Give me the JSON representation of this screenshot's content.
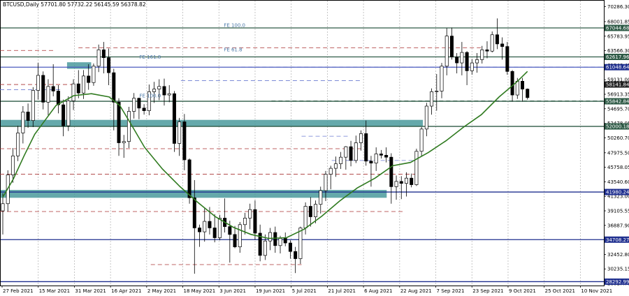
{
  "chart_data": {
    "type": "candlestick",
    "title": "BTCUSD,Daily  57701.80  57732.22  56145.59  56378.82",
    "y_tick_labels": [
      "70286.30",
      "68001.85",
      "65783.95",
      "63566.30",
      "61348.45",
      "59131.00",
      "56913.35",
      "54695.70",
      "52478.05",
      "50260.70",
      "47975.50",
      "45758.05",
      "43540.60",
      "41323.00",
      "39105.55",
      "36887.90",
      "34670.25",
      "32452.80",
      "30235.15",
      "28017.70"
    ],
    "x_tick_labels": [
      "27 Feb 2021",
      "15 Mar 2021",
      "31 Mar 2021",
      "16 Apr 2021",
      "2 May 2021",
      "18 May 2021",
      "3 Jun 2021",
      "19 Jun 2021",
      "5 Jul 2021",
      "21 Jul 2021",
      "6 Aug 2021",
      "22 Aug 2021",
      "7 Sep 2021",
      "23 Sep 2021",
      "9 Oct 2021",
      "25 Oct 2021",
      "10 Nov 2021"
    ],
    "ylim": [
      27700,
      71200
    ],
    "price_boxes": [
      {
        "text": "67044.68",
        "value": 67044.68,
        "color": "#2e5a46",
        "line": "#2e5a46"
      },
      {
        "text": "62617.96",
        "value": 62617.96,
        "color": "#2e5a46",
        "line": "#2e5a46"
      },
      {
        "text": "61048.64",
        "value": 61048.64,
        "color": "#1f2f8f",
        "line": "#4b5bbf"
      },
      {
        "text": "58141.84",
        "value": 58400,
        "color": "#222222",
        "line": ""
      },
      {
        "text": "55842.84",
        "value": 55842.84,
        "color": "#2e5a46",
        "line": "#2e5a46"
      },
      {
        "text": "52000.18",
        "value": 52000.18,
        "color": "#2e5a46",
        "line": "#2e5a46"
      },
      {
        "text": "41980.24",
        "value": 41980.24,
        "color": "#1f2f8f",
        "line": "#1f2f8f"
      },
      {
        "text": "34708.27",
        "value": 34708.27,
        "color": "#1f2f8f",
        "line": "#1f2f8f"
      },
      {
        "text": "28292.99",
        "value": 28292.99,
        "color": "#1f2f8f",
        "line": "#1f2f8f"
      }
    ],
    "fib_labels": [
      {
        "text": "FE 100.0",
        "value": 67044.68,
        "x_frac": 0.37
      },
      {
        "text": "FE 61.8",
        "value": 63300,
        "x_frac": 0.37
      },
      {
        "text": "FE 161.8",
        "value": 62200,
        "x_frac": 0.23
      },
      {
        "text": "FE 100.0",
        "value": 56250,
        "x_frac": 0.23
      }
    ],
    "zones": [
      {
        "from": 52000,
        "to": 53000,
        "x0": 0.0,
        "x1": 0.7,
        "color": "#4a9a9c"
      },
      {
        "from": 41100,
        "to": 42300,
        "x0": 0.0,
        "x1": 0.64,
        "color": "#4a9a9c"
      },
      {
        "from": 60800,
        "to": 61800,
        "x0": 0.11,
        "x1": 0.15,
        "color": "#4a9a9c"
      }
    ],
    "ma_points": [
      [
        0,
        41200
      ],
      [
        6,
        44000
      ],
      [
        12,
        47500
      ],
      [
        18,
        50800
      ],
      [
        24,
        53000
      ],
      [
        30,
        55200
      ],
      [
        40,
        56700
      ],
      [
        50,
        57000
      ],
      [
        60,
        56500
      ],
      [
        66,
        55200
      ],
      [
        72,
        52500
      ],
      [
        80,
        48800
      ],
      [
        90,
        45500
      ],
      [
        100,
        42800
      ],
      [
        110,
        40400
      ],
      [
        120,
        38200
      ],
      [
        130,
        36600
      ],
      [
        140,
        35500
      ],
      [
        150,
        34900
      ],
      [
        160,
        35000
      ],
      [
        170,
        36300
      ],
      [
        180,
        38300
      ],
      [
        190,
        40600
      ],
      [
        200,
        42600
      ],
      [
        210,
        44100
      ],
      [
        220,
        46000
      ],
      [
        230,
        46500
      ],
      [
        240,
        48000
      ],
      [
        250,
        49800
      ],
      [
        260,
        51900
      ],
      [
        270,
        53800
      ],
      [
        280,
        56500
      ],
      [
        290,
        58800
      ],
      [
        296,
        60400
      ]
    ],
    "candles": [
      [
        0,
        39100,
        41800,
        35500,
        40200
      ],
      [
        1,
        40200,
        45300,
        39000,
        44600
      ],
      [
        2,
        44600,
        48700,
        43400,
        47500
      ],
      [
        3,
        47500,
        52100,
        46700,
        51000
      ],
      [
        4,
        51000,
        55100,
        49400,
        54200
      ],
      [
        5,
        54200,
        55500,
        51800,
        52900
      ],
      [
        6,
        52900,
        58000,
        51900,
        57500
      ],
      [
        7,
        57500,
        61700,
        56100,
        59800
      ],
      [
        8,
        59800,
        60400,
        54600,
        55700
      ],
      [
        9,
        55700,
        59200,
        53700,
        58100
      ],
      [
        10,
        58100,
        61500,
        56600,
        57400
      ],
      [
        11,
        57400,
        58300,
        54000,
        55300
      ],
      [
        12,
        55300,
        56100,
        50500,
        52100
      ],
      [
        13,
        52100,
        56600,
        51300,
        55900
      ],
      [
        14,
        55900,
        59200,
        54500,
        58500
      ],
      [
        15,
        58500,
        60600,
        56300,
        57100
      ],
      [
        16,
        57100,
        60600,
        56200,
        59700
      ],
      [
        17,
        59700,
        61500,
        57600,
        58700
      ],
      [
        18,
        58700,
        61600,
        58200,
        61200
      ],
      [
        19,
        61200,
        64500,
        60300,
        63700
      ],
      [
        20,
        63700,
        64900,
        60100,
        62500
      ],
      [
        21,
        62500,
        63900,
        58300,
        60200
      ],
      [
        22,
        60200,
        60800,
        51400,
        55700
      ],
      [
        23,
        55700,
        56300,
        47500,
        49500
      ],
      [
        24,
        49500,
        50700,
        47200,
        49700
      ],
      [
        25,
        49700,
        55000,
        48700,
        54300
      ],
      [
        26,
        54300,
        57100,
        53200,
        56300
      ],
      [
        27,
        56300,
        56400,
        53100,
        54800
      ],
      [
        28,
        54800,
        55400,
        53800,
        54400
      ],
      [
        29,
        54400,
        58400,
        53700,
        57300
      ],
      [
        30,
        57300,
        58800,
        55600,
        57700
      ],
      [
        31,
        57700,
        59200,
        56000,
        58100
      ],
      [
        32,
        58100,
        59300,
        55200,
        56800
      ],
      [
        33,
        56800,
        58300,
        55700,
        57000
      ],
      [
        34,
        57000,
        57400,
        48100,
        49400
      ],
      [
        35,
        49400,
        53300,
        47500,
        52700
      ],
      [
        36,
        52700,
        53900,
        45300,
        46900
      ],
      [
        37,
        46900,
        47100,
        40200,
        41100
      ],
      [
        38,
        41100,
        43800,
        29500,
        36500
      ],
      [
        39,
        36500,
        37000,
        33600,
        35900
      ],
      [
        40,
        35900,
        39500,
        34400,
        37500
      ],
      [
        41,
        37500,
        39700,
        35500,
        36500
      ],
      [
        42,
        36500,
        38600,
        34300,
        35000
      ],
      [
        43,
        35000,
        38500,
        34600,
        38000
      ],
      [
        44,
        38000,
        41000,
        35800,
        36700
      ],
      [
        45,
        36700,
        37600,
        31200,
        35500
      ],
      [
        46,
        35500,
        36800,
        33400,
        33600
      ],
      [
        47,
        33600,
        37400,
        32700,
        37000
      ],
      [
        48,
        37000,
        38800,
        35500,
        38000
      ],
      [
        49,
        38000,
        40200,
        36300,
        39300
      ],
      [
        50,
        39300,
        40700,
        34700,
        35700
      ],
      [
        51,
        35700,
        37000,
        31400,
        32300
      ],
      [
        52,
        32300,
        35500,
        31600,
        34500
      ],
      [
        53,
        34500,
        36500,
        33100,
        35800
      ],
      [
        54,
        35800,
        36700,
        32700,
        33800
      ],
      [
        55,
        33800,
        35300,
        32600,
        34900
      ],
      [
        56,
        34900,
        35800,
        33700,
        34200
      ],
      [
        57,
        34200,
        34600,
        31800,
        32900
      ],
      [
        58,
        32900,
        33600,
        29600,
        31800
      ],
      [
        59,
        31800,
        36700,
        31000,
        36500
      ],
      [
        60,
        36500,
        40400,
        35500,
        39800
      ],
      [
        61,
        39800,
        41200,
        36700,
        38200
      ],
      [
        62,
        38200,
        40700,
        37200,
        40100
      ],
      [
        63,
        40100,
        42800,
        38700,
        42200
      ],
      [
        64,
        42200,
        45200,
        40600,
        44700
      ],
      [
        65,
        44700,
        46000,
        42400,
        45600
      ],
      [
        66,
        45600,
        47400,
        44300,
        46300
      ],
      [
        67,
        46300,
        48100,
        45500,
        47300
      ],
      [
        68,
        47300,
        49000,
        45400,
        48900
      ],
      [
        69,
        48900,
        49800,
        45900,
        46800
      ],
      [
        70,
        46800,
        50600,
        46400,
        49500
      ],
      [
        71,
        49500,
        51400,
        48300,
        50900
      ],
      [
        72,
        50900,
        52900,
        46000,
        46700
      ],
      [
        73,
        46700,
        47500,
        42800,
        46400
      ],
      [
        74,
        46400,
        48800,
        45200,
        47800
      ],
      [
        75,
        47800,
        48400,
        47100,
        47600
      ],
      [
        76,
        47600,
        48800,
        46500,
        47300
      ],
      [
        77,
        47300,
        47900,
        40200,
        42800
      ],
      [
        78,
        42800,
        44500,
        40800,
        43600
      ],
      [
        79,
        43600,
        44400,
        40900,
        43300
      ],
      [
        80,
        43300,
        45000,
        41300,
        44100
      ],
      [
        81,
        44100,
        44800,
        42700,
        43100
      ],
      [
        82,
        43100,
        48600,
        42900,
        48200
      ],
      [
        83,
        48200,
        51900,
        47500,
        51600
      ],
      [
        84,
        51600,
        55600,
        50500,
        55100
      ],
      [
        85,
        55100,
        57800,
        53800,
        57300
      ],
      [
        86,
        57300,
        60000,
        54400,
        57400
      ],
      [
        87,
        57400,
        61700,
        56300,
        61200
      ],
      [
        88,
        61200,
        67000,
        59800,
        65800
      ],
      [
        89,
        65800,
        67100,
        62200,
        62600
      ],
      [
        90,
        62600,
        63200,
        60100,
        61700
      ],
      [
        91,
        61700,
        64900,
        59800,
        63300
      ],
      [
        92,
        63300,
        63500,
        58300,
        60500
      ],
      [
        93,
        60500,
        62300,
        59900,
        61700
      ],
      [
        94,
        61700,
        63200,
        60200,
        62200
      ],
      [
        95,
        62200,
        64300,
        61600,
        63700
      ],
      [
        96,
        63700,
        65000,
        62400,
        63500
      ],
      [
        97,
        63500,
        66500,
        63300,
        66000
      ],
      [
        98,
        66000,
        68500,
        63800,
        64600
      ],
      [
        99,
        64600,
        65600,
        62200,
        64200
      ],
      [
        100,
        64200,
        64900,
        59900,
        60400
      ],
      [
        101,
        60400,
        60600,
        55800,
        56800
      ],
      [
        102,
        56800,
        59400,
        56200,
        58900
      ],
      [
        103,
        58900,
        59400,
        55800,
        57700
      ],
      [
        104,
        57700,
        57800,
        56100,
        56400
      ]
    ]
  }
}
